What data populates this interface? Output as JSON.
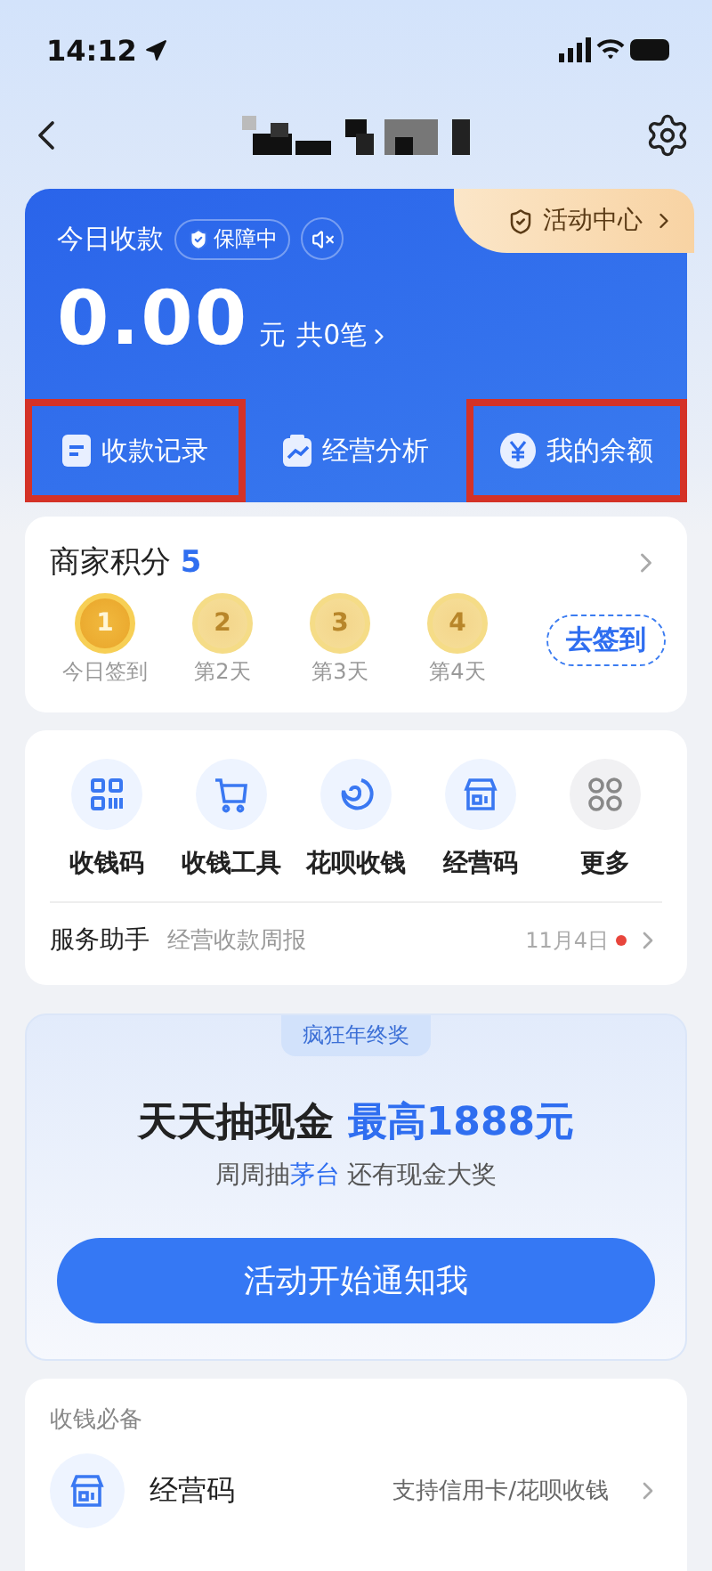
{
  "status_bar": {
    "time": "14:12"
  },
  "today_card": {
    "label": "今日收款",
    "badge": "保障中",
    "muted": true,
    "amount": "0.00",
    "unit": "元",
    "count": "共0笔",
    "activity": "活动中心",
    "actions": [
      {
        "label": "收款记录",
        "kind": "record",
        "highlighted": true
      },
      {
        "label": "经营分析",
        "kind": "analysis",
        "highlighted": false
      },
      {
        "label": "我的余额",
        "kind": "yuan",
        "highlighted": true
      }
    ]
  },
  "points": {
    "title": "商家积分",
    "value": "5",
    "button": "去签到",
    "days": [
      {
        "number": "1",
        "label": "今日签到",
        "selected": true
      },
      {
        "number": "2",
        "label": "第2天",
        "selected": false
      },
      {
        "number": "3",
        "label": "第3天",
        "selected": false
      },
      {
        "number": "4",
        "label": "第4天",
        "selected": false
      }
    ]
  },
  "tools": {
    "items": [
      {
        "label": "收钱码",
        "kind": "qr"
      },
      {
        "label": "收钱工具",
        "kind": "cart"
      },
      {
        "label": "花呗收钱",
        "kind": "huabei"
      },
      {
        "label": "经营码",
        "kind": "store"
      },
      {
        "label": "更多",
        "kind": "more"
      }
    ],
    "assistant": {
      "title": "服务助手",
      "subtitle": "经营收款周报",
      "date": "11月4日",
      "unread": true
    }
  },
  "promo": {
    "tag": "疯狂年终奖",
    "headline": "天天抽现金",
    "highlight": "最高1888元",
    "subline": [
      {
        "text": "周周抽",
        "accent": false
      },
      {
        "text": "茅台",
        "accent": true
      },
      {
        "text": " 还有现金大奖",
        "accent": false
      }
    ],
    "button": "活动开始通知我"
  },
  "essentials": {
    "title": "收钱必备",
    "items": [
      {
        "name": "经营码",
        "note": "支持信用卡/花呗收钱",
        "kind": "store"
      }
    ]
  }
}
